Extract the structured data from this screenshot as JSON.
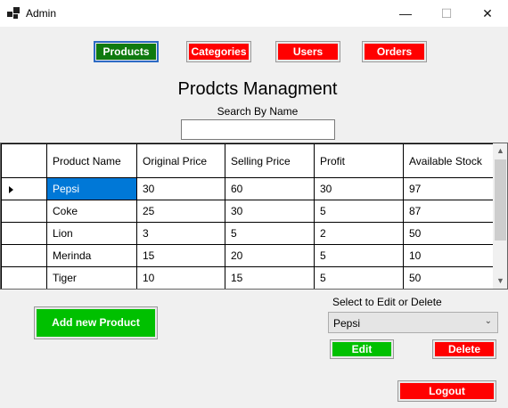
{
  "window": {
    "title": "Admin",
    "minimize_glyph": "—",
    "maximize_glyph": "☐",
    "close_glyph": "✕"
  },
  "nav": {
    "products": "Products",
    "categories": "Categories",
    "users": "Users",
    "orders": "Orders"
  },
  "main": {
    "page_title": "Prodcts Managment",
    "search_label": "Search By Name",
    "search_value": ""
  },
  "grid": {
    "columns": [
      "Product Name",
      "Original Price",
      "Selling Price",
      "Profit",
      "Available Stock"
    ],
    "rows": [
      [
        "Pepsi",
        "30",
        "60",
        "30",
        "97"
      ],
      [
        "Coke",
        "25",
        "30",
        "5",
        "87"
      ],
      [
        "Lion",
        "3",
        "5",
        "2",
        "50"
      ],
      [
        "Merinda",
        "15",
        "20",
        "5",
        "10"
      ],
      [
        "Tiger",
        "10",
        "15",
        "5",
        "50"
      ]
    ],
    "selected_row": 0
  },
  "actions": {
    "add_product": "Add new Product",
    "select_label": "Select to Edit or Delete",
    "selected_product": "Pepsi",
    "edit": "Edit",
    "delete": "Delete",
    "logout": "Logout"
  },
  "icons": {
    "app": "app-window-icon",
    "dropdown": "chevron-down-icon",
    "scroll_up": "scroll-up-arrow-icon",
    "scroll_down": "scroll-down-arrow-icon",
    "row_selector": "row-pointer-icon"
  },
  "colors": {
    "nav_active": "#0f7a0f",
    "nav_inactive": "#ff0000",
    "add_button": "#00c000",
    "edit_button": "#00c000",
    "delete_button": "#ff0000",
    "logout_button": "#ff0000",
    "selected_cell": "#0078d7"
  }
}
